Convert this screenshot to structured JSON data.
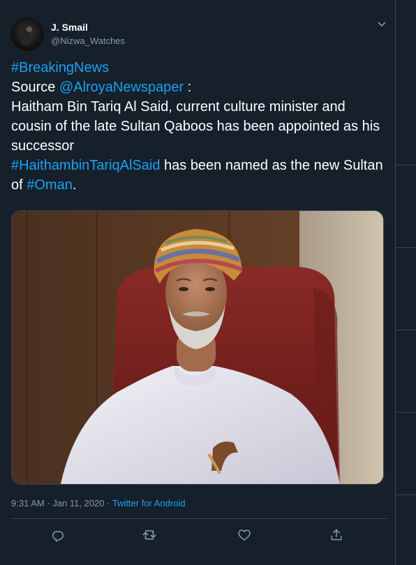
{
  "tweet": {
    "author": {
      "display_name": "J. Smail",
      "handle": "@Nizwa_Watches"
    },
    "body": {
      "hashtag_breaking": "#BreakingNews",
      "source_label": "Source ",
      "source_mention": "@AlroyaNewspaper",
      "source_suffix": " :",
      "announcement": "Haitham Bin Tariq Al Said,  current culture minister and cousin of the late Sultan Qaboos has been appointed as his successor",
      "hashtag_name": "#HaithambinTariqAlSaid",
      "named_text": " has been named as the new Sultan of ",
      "hashtag_oman": "#Oman",
      "end_punct": "."
    },
    "meta": {
      "time": "9:31 AM",
      "separator": " · ",
      "date": "Jan 11, 2020",
      "separator2": " · ",
      "source_app": "Twitter for Android"
    },
    "actions": {
      "reply_icon": "reply-icon",
      "retweet_icon": "retweet-icon",
      "like_icon": "heart-icon",
      "share_icon": "share-icon"
    },
    "colors": {
      "background": "#15202b",
      "text": "#ffffff",
      "secondary_text": "#8899a6",
      "link": "#1da1f2",
      "border": "#38444d"
    }
  }
}
